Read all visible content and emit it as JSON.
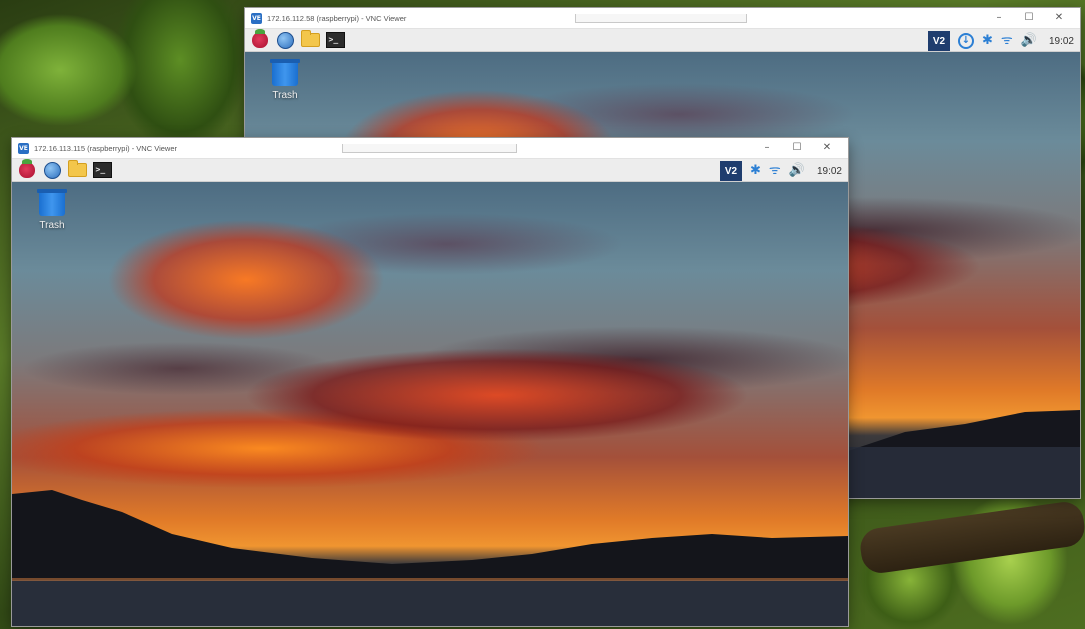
{
  "back_window": {
    "title": "172.16.112.58 (raspberrypi) - VNC Viewer",
    "app_icon": "VE",
    "controls": {
      "minimize": "–",
      "maximize": "☐",
      "close": "✕"
    },
    "taskbar": {
      "vnc_tray": "V2",
      "update_glyph": "↓",
      "bluetooth_glyph": "✱",
      "wifi_glyph": "ᯤ",
      "volume_glyph": "🔊",
      "clock": "19:02",
      "terminal_glyph": ">_"
    },
    "desktop": {
      "trash_label": "Trash"
    }
  },
  "front_window": {
    "title": "172.16.113.115 (raspberrypi) - VNC Viewer",
    "app_icon": "VE",
    "controls": {
      "minimize": "–",
      "maximize": "☐",
      "close": "✕"
    },
    "taskbar": {
      "vnc_tray": "V2",
      "bluetooth_glyph": "✱",
      "wifi_glyph": "ᯤ",
      "volume_glyph": "🔊",
      "clock": "19:02",
      "terminal_glyph": ">_"
    },
    "desktop": {
      "trash_label": "Trash"
    }
  },
  "colors": {
    "vnc_brand": "#1f3d6e",
    "tray_blue": "#2c7fd4",
    "raspberry": "#c0163f",
    "folder": "#f3c64b"
  }
}
